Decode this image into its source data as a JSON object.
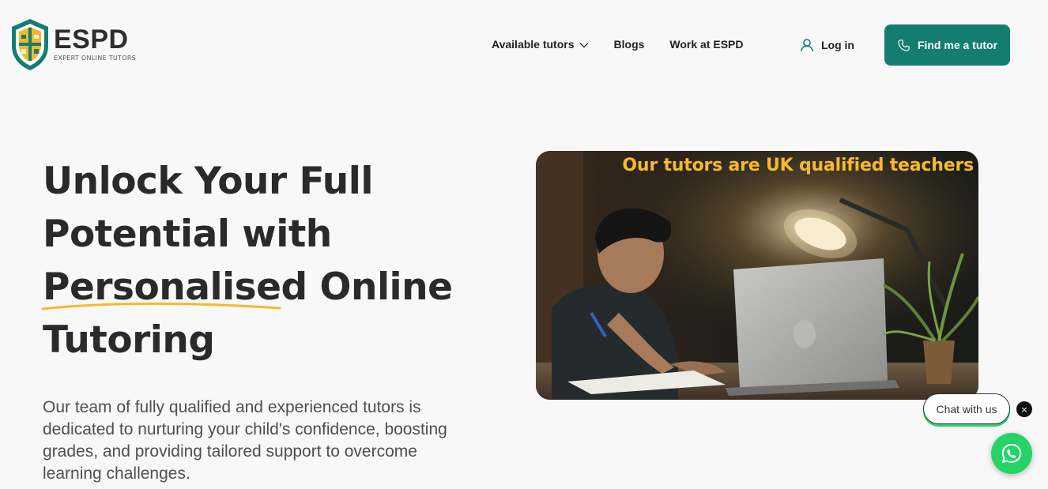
{
  "header": {
    "logo": {
      "name": "ESPD",
      "tagline": "EXPERT ONLINE TUTORS"
    },
    "nav": [
      {
        "label": "Available tutors",
        "has_dropdown": true
      },
      {
        "label": "Blogs"
      },
      {
        "label": "Work at ESPD"
      }
    ],
    "login_label": "Log in",
    "cta_label": "Find me a tutor"
  },
  "hero": {
    "title_line1": "Unlock Your Full",
    "title_line2": "Potential with",
    "title_highlight": "Personalised",
    "title_line3_rest": " Online",
    "title_line4": "Tutoring",
    "description": "Our team of fully qualified and experienced tutors is dedicated to nurturing your child's confidence, boosting grades, and providing tailored support to overcome learning challenges.",
    "image_caption": "Our tutors are UK qualified teachers"
  },
  "chat": {
    "bubble_label": "Chat with us",
    "close_icon": "×"
  },
  "colors": {
    "brand_teal": "#137d72",
    "highlight_yellow": "#f6b92e",
    "whatsapp_green": "#25d366"
  },
  "icons": [
    "chevron-down-icon",
    "user-icon",
    "phone-icon",
    "close-icon",
    "whatsapp-icon"
  ]
}
